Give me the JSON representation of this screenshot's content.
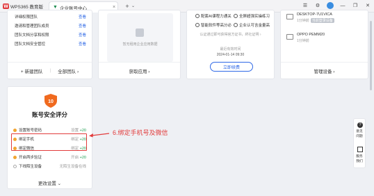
{
  "browser": {
    "app_name": "WPS365 教育版",
    "tab_title": "企业账号中心",
    "new_tab": "+",
    "dropdown": "⌄",
    "tab_close": "×",
    "controls": {
      "minimize": "—",
      "maximize": "❐",
      "close": "✕"
    }
  },
  "team_card": {
    "rows": [
      {
        "name": "详细权限团队",
        "action": "查看"
      },
      {
        "name": "邀请和管理团队成员",
        "action": "查看"
      },
      {
        "name": "团队文档分享和权限",
        "action": "查看"
      },
      {
        "name": "团队文档安全管控",
        "action": "查看"
      }
    ],
    "new_team": "+ 新建团队",
    "all_teams": "全部团队 ›"
  },
  "apps_card": {
    "placeholder_text": "暂无租用企业应用数据",
    "footer": "获取应用 ›"
  },
  "service_card": {
    "rows": [
      {
        "left": "配套AI课程力通关",
        "right": "全屏超强实操练习"
      },
      {
        "left": "智能软件等高分必",
        "right": "企业认可含金量高"
      }
    ],
    "cert_note": "认证通过即可获得官方证书，終社证明 ›",
    "expire_label": "最近有效时间",
    "expire_date": "2024-01-14 09:30",
    "renew_button": "立即续费"
  },
  "device_card": {
    "devices": [
      {
        "name": "DESKTOP-7U1VICA",
        "time": "1分钟前",
        "tag": "当前登录设备"
      },
      {
        "name": "OPPO PEMM20",
        "time": "1分钟前",
        "tag": ""
      }
    ],
    "footer": "管理设备 ›"
  },
  "security_card": {
    "score": "10",
    "title": "账号安全评分",
    "rows": [
      {
        "label": "设置账号密码",
        "status": "设置",
        "points": "+20",
        "dot": "orange"
      },
      {
        "label": "绑定手机",
        "status": "绑定",
        "points": "+20",
        "dot": "orange"
      },
      {
        "label": "绑定微信",
        "status": "绑定",
        "points": "+20",
        "dot": "orange"
      },
      {
        "label": "开启两步验证",
        "status": "开启",
        "points": "+20",
        "dot": "orange"
      },
      {
        "label": "下线陌生设备",
        "status": "无陌生设备在线",
        "points": "",
        "dot": "grey"
      }
    ],
    "footer": "更改设置 ⌄"
  },
  "annotation": {
    "text": "6.绑定手机号及微信",
    "color": "#e23b3b"
  },
  "helper": {
    "help_label_1": "意见",
    "help_label_2": "问题",
    "service_label_1": "服务",
    "service_label_2": "我们"
  },
  "colors": {
    "link": "#2e68e6",
    "score_badge": "#f06a1f",
    "ok": "#1b9d4f",
    "warn": "#f2a531"
  }
}
